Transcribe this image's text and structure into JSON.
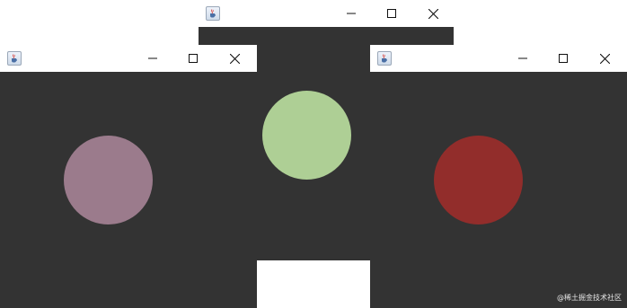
{
  "windows": [
    {
      "id": "purple",
      "circle_color": "#9b7b8c"
    },
    {
      "id": "green",
      "circle_color": "#aecf95"
    },
    {
      "id": "red",
      "circle_color": "#922d2b"
    }
  ],
  "icons": {
    "app": "java-cup-icon",
    "minimize": "minimize-icon",
    "maximize": "maximize-icon",
    "close": "close-icon"
  },
  "colors": {
    "titlebar": "#ffffff",
    "canvas": "#333333",
    "desktop": "#ffffff"
  },
  "watermark": "@稀土掘金技术社区"
}
